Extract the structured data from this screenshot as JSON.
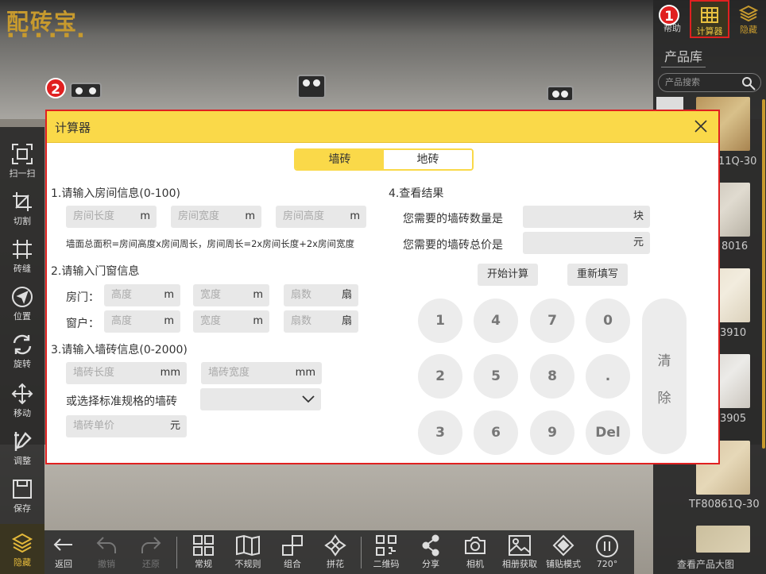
{
  "app": {
    "logo": "配砖宝",
    "logo_sub": "■■■■■■"
  },
  "left_toolbar": [
    {
      "label": "扫一扫"
    },
    {
      "label": "切割"
    },
    {
      "label": "砖缝"
    },
    {
      "label": "位置"
    },
    {
      "label": "旋转"
    },
    {
      "label": "移动"
    },
    {
      "label": "调整"
    },
    {
      "label": "保存"
    },
    {
      "label": "隐藏"
    }
  ],
  "bottom_toolbar": [
    {
      "label": "返回"
    },
    {
      "label": "撤销"
    },
    {
      "label": "还原"
    },
    {
      "label": "常规"
    },
    {
      "label": "不规则"
    },
    {
      "label": "组合"
    },
    {
      "label": "拼花"
    },
    {
      "label": "二维码"
    },
    {
      "label": "分享"
    },
    {
      "label": "相机"
    },
    {
      "label": "相册获取"
    },
    {
      "label": "铺贴模式"
    },
    {
      "label": "720°"
    }
  ],
  "right_panel": {
    "help": "帮助",
    "calculator": "计算器",
    "hide": "隐藏",
    "title": "产品库",
    "search_placeholder": "产品搜索",
    "codes": [
      "11Q-30",
      "8016",
      "3910",
      "3905",
      "TF80861Q-30"
    ],
    "view_big": "查看产品大图"
  },
  "callouts": {
    "one": "1",
    "two": "2"
  },
  "dialog": {
    "title": "计算器",
    "tabs": {
      "wall": "墙砖",
      "floor": "地砖"
    },
    "sec1": "1.请输入房间信息(0-100)",
    "room": {
      "length": "房间长度",
      "width": "房间宽度",
      "height": "房间高度",
      "unit": "m"
    },
    "note": "墙面总面积=房间高度x房间周长，房间周长=2x房间长度+2x房间宽度",
    "sec2": "2.请输入门窗信息",
    "door": {
      "label": "房门：",
      "height": "高度",
      "width": "宽度",
      "count": "扇数",
      "unit_m": "m",
      "unit_count": "扇"
    },
    "window": {
      "label": "窗户：",
      "height": "高度",
      "width": "宽度",
      "count": "扇数",
      "unit_m": "m",
      "unit_count": "扇"
    },
    "sec3": "3.请输入墙砖信息(0-2000)",
    "tile": {
      "length": "墙砖长度",
      "width": "墙砖宽度",
      "unit": "mm"
    },
    "standard_label": "或选择标准规格的墙砖",
    "price": {
      "placeholder": "墙砖单价",
      "unit": "元"
    },
    "sec4": "4.查看结果",
    "result_count_label": "您需要的墙砖数量是",
    "result_count_unit": "块",
    "result_price_label": "您需要的墙砖总价是",
    "result_price_unit": "元",
    "btn_calc": "开始计算",
    "btn_reset": "重新填写",
    "keys": [
      "1",
      "4",
      "7",
      "0",
      "2",
      "5",
      "8",
      ".",
      "3",
      "6",
      "9",
      "Del"
    ],
    "clear_top": "清",
    "clear_bottom": "除"
  }
}
